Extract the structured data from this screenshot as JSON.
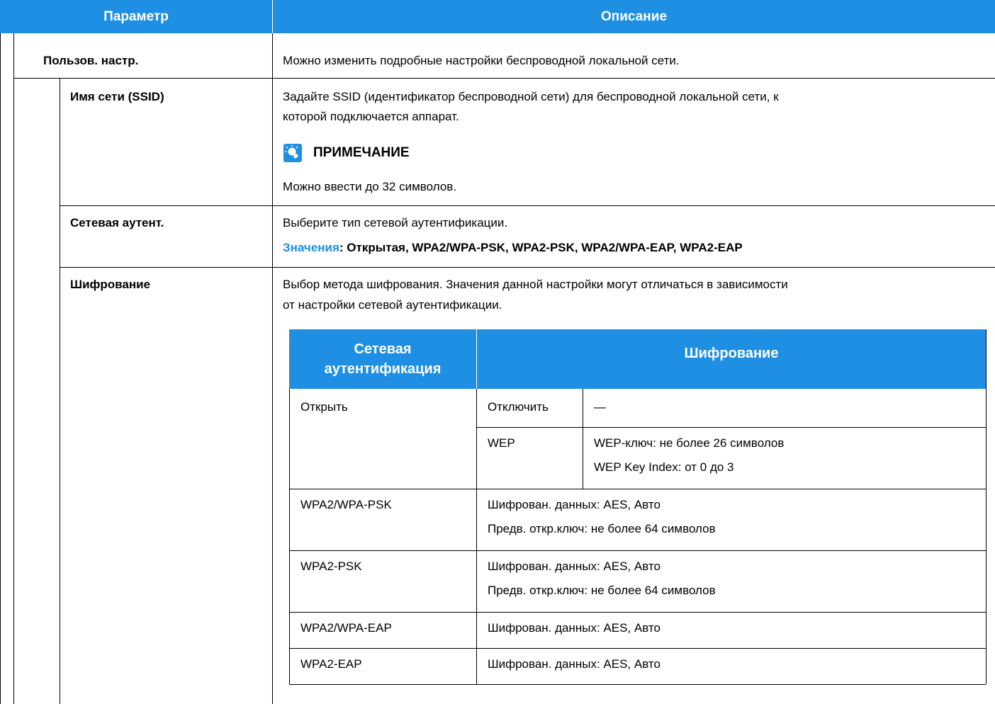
{
  "header": {
    "col1": "Параметр",
    "col2": "Описание"
  },
  "rows": {
    "custom": {
      "param": "Пользов. настр.",
      "desc": "Можно изменить подробные настройки беспроводной локальной сети."
    },
    "ssid": {
      "param": "Имя сети (SSID)",
      "desc_line1": "Задайте SSID (идентификатор беспроводной сети) для беспроводной локальной сети, к",
      "desc_line2": "которой подключается аппарат.",
      "note_title": "ПРИМЕЧАНИЕ",
      "note_icon": "lightbulb-note-icon",
      "note_text": "Можно ввести до 32 символов."
    },
    "auth": {
      "param": "Сетевая аутент.",
      "desc": "Выберите тип сетевой аутентификации.",
      "values_label": "Значения",
      "values_text": ": Открытая, WPA2/WPA-PSK, WPA2-PSK, WPA2/WPA-EAP, WPA2-EAP"
    },
    "encryption": {
      "param": "Шифрование",
      "desc_line1": "Выбор метода шифрования. Значения данной настройки могут отличаться в зависимости",
      "desc_line2": "от настройки сетевой аутентификации."
    }
  },
  "inner_table": {
    "header_auth_line1": "Сетевая",
    "header_auth_line2": "аутентификация",
    "header_enc": "Шифрование",
    "open": {
      "auth": "Открыть",
      "disable": "Отключить",
      "disable_value": "—",
      "wep": "WEP",
      "wep_line1": "WEP-ключ: не более 26 символов",
      "wep_line2": "WEP Key Index: от 0 до 3"
    },
    "wpa2_wpa_psk": {
      "auth": "WPA2/WPA-PSK",
      "line1": "Шифрован. данных: AES, Авто",
      "line2": "Предв. откр.ключ: не более 64 символов"
    },
    "wpa2_psk": {
      "auth": "WPA2-PSK",
      "line1": "Шифрован. данных: AES, Авто",
      "line2": "Предв. откр.ключ: не более 64 символов"
    },
    "wpa2_wpa_eap": {
      "auth": "WPA2/WPA-EAP",
      "line1": "Шифрован. данных: AES, Авто"
    },
    "wpa2_eap": {
      "auth": "WPA2-EAP",
      "line1": "Шифрован. данных: AES, Авто"
    }
  },
  "colors": {
    "header_blue": "#1e8fe3"
  }
}
